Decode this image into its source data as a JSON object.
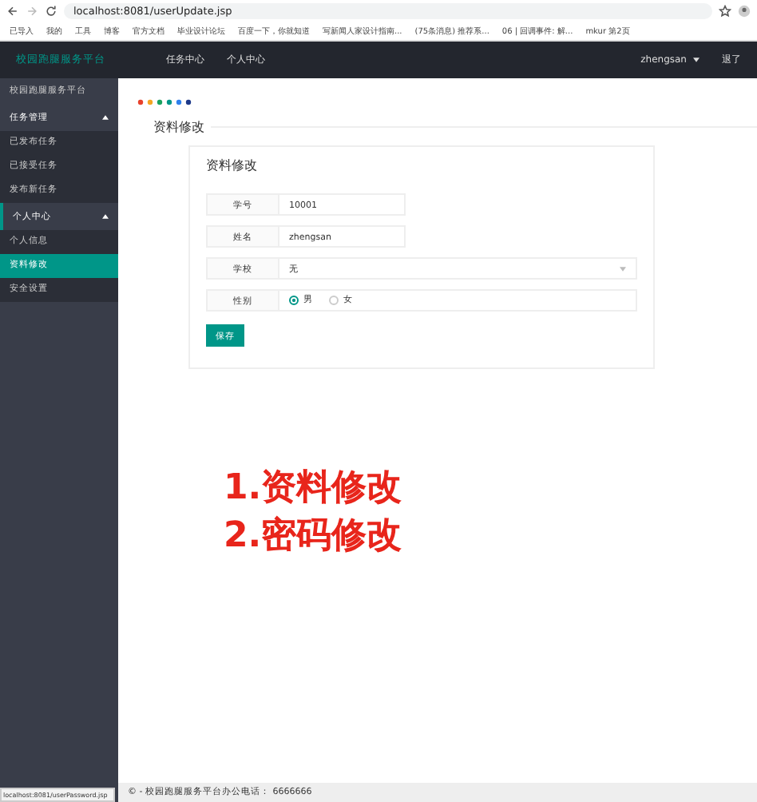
{
  "browser": {
    "url": "localhost:8081/userUpdate.jsp",
    "bookmarks": [
      "已导入",
      "我的",
      "工具",
      "博客",
      "官方文档",
      "毕业设计论坛",
      "百度一下，你就知道",
      "写新闻人家设计指南...",
      "(75条消息) 推荐系...",
      "06 | 回调事件: 解...",
      "mkur 第2页"
    ]
  },
  "navbar": {
    "brand": "校园跑腿服务平台",
    "items": [
      "任务中心",
      "个人中心"
    ],
    "user": "zhengsan",
    "logout": "退了"
  },
  "sidebar": {
    "title": "校园跑腿服务平台",
    "groups": [
      {
        "label": "任务管理",
        "expanded": true,
        "selected": false,
        "items": [
          {
            "label": "已发布任务",
            "selected": false
          },
          {
            "label": "已接受任务",
            "selected": false
          },
          {
            "label": "发布新任务",
            "selected": false
          }
        ]
      },
      {
        "label": "个人中心",
        "expanded": true,
        "selected": true,
        "items": [
          {
            "label": "个人信息",
            "selected": false
          },
          {
            "label": "资料修改",
            "selected": true
          },
          {
            "label": "安全设置",
            "selected": false
          }
        ]
      }
    ]
  },
  "page_title": "资料修改",
  "form": {
    "title": "资料修改",
    "fields": [
      {
        "kind": "input",
        "label": "学号",
        "value": "10001"
      },
      {
        "kind": "input",
        "label": "姓名",
        "value": "zhengsan"
      },
      {
        "kind": "select",
        "label": "学校",
        "value": "无"
      },
      {
        "kind": "radio",
        "label": "性别",
        "options": [
          {
            "label": "男",
            "selected": true
          },
          {
            "label": "女",
            "selected": false
          }
        ]
      }
    ],
    "submit": "保存"
  },
  "annotations": [
    "1.资料修改",
    "2.密码修改"
  ],
  "footer": "© - 校园跑腿服务平台办公电话： 6666666",
  "status_url": "localhost:8081/userPassword.jsp"
}
